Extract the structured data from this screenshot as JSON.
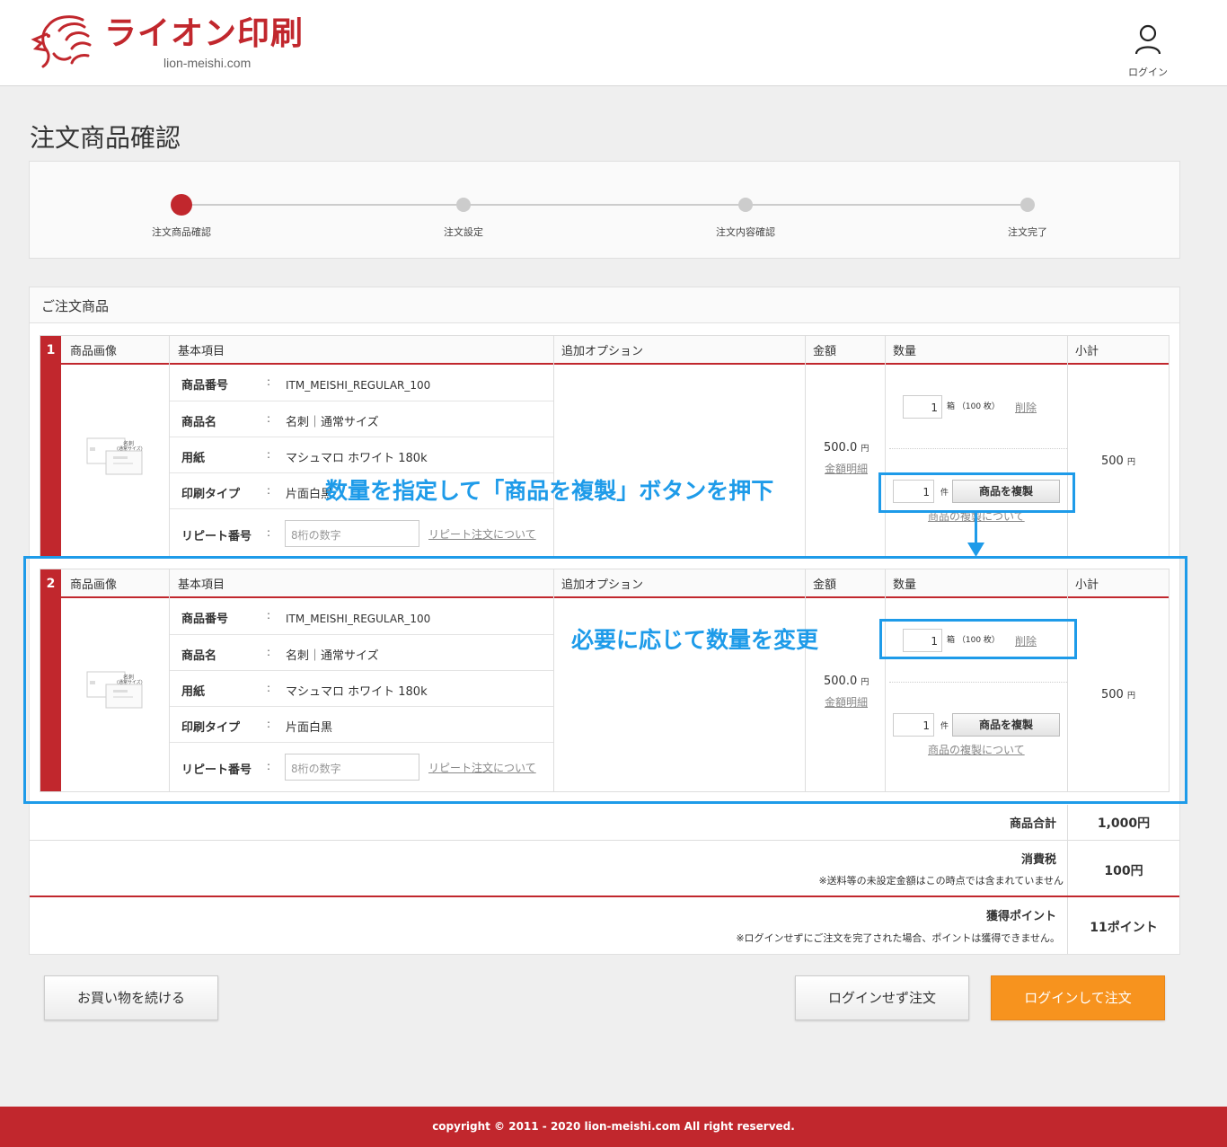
{
  "header": {
    "brand": "ライオン印刷",
    "domain": "lion-meishi.com",
    "login_label": "ログイン"
  },
  "page_title": "注文商品確認",
  "steps": [
    "注文商品確認",
    "注文設定",
    "注文内容確認",
    "注文完了"
  ],
  "order_section_title": "ご注文商品",
  "columns": {
    "image": "商品画像",
    "basic": "基本項目",
    "options": "追加オプション",
    "price": "金額",
    "quantity": "数量",
    "subtotal": "小計"
  },
  "field_labels": {
    "code": "商品番号",
    "name": "商品名",
    "paper": "用紙",
    "print_type": "印刷タイプ",
    "repeat": "リピート番号"
  },
  "colon": ":",
  "items": [
    {
      "num": "1",
      "code": "ITM_MEISHI_REGULAR_100",
      "name": "名刺｜通常サイズ",
      "paper": "マシュマロ ホワイト 180k",
      "print_type": "片面白黒",
      "repeat_placeholder": "8桁の数字",
      "repeat_link": "リピート注文について",
      "price": "500.0",
      "price_unit": "円",
      "price_detail": "金額明細",
      "qty": "1",
      "qty_unit": "箱",
      "qty_note": "（100 枚）",
      "delete": "削除",
      "copy_qty": "1",
      "copy_unit": "件",
      "copy_button": "商品を複製",
      "copy_link": "商品の複製について",
      "subtotal": "500",
      "subtotal_unit": "円",
      "thumb_title": "名刺",
      "thumb_sub": "(通常サイズ)"
    },
    {
      "num": "2",
      "code": "ITM_MEISHI_REGULAR_100",
      "name": "名刺｜通常サイズ",
      "paper": "マシュマロ ホワイト 180k",
      "print_type": "片面白黒",
      "repeat_placeholder": "8桁の数字",
      "repeat_link": "リピート注文について",
      "price": "500.0",
      "price_unit": "円",
      "price_detail": "金額明細",
      "qty": "1",
      "qty_unit": "箱",
      "qty_note": "（100 枚）",
      "delete": "削除",
      "copy_qty": "1",
      "copy_unit": "件",
      "copy_button": "商品を複製",
      "copy_link": "商品の複製について",
      "subtotal": "500",
      "subtotal_unit": "円",
      "thumb_title": "名刺",
      "thumb_sub": "(通常サイズ)"
    }
  ],
  "totals": {
    "goods_label": "商品合計",
    "goods_value": "1,000円",
    "tax_label": "消費税",
    "tax_note": "※送料等の未設定金額はこの時点では含まれていません",
    "tax_value": "100円",
    "points_label": "獲得ポイント",
    "points_note": "※ログインせずにご注文を完了された場合、ポイントは獲得できません。",
    "points_value": "11ポイント"
  },
  "buttons": {
    "continue": "お買い物を続ける",
    "guest_order": "ログインせず注文",
    "login_order": "ログインして注文"
  },
  "annotations": {
    "copy_hint": "数量を指定して「商品を複製」ボタンを押下",
    "change_hint": "必要に応じて数量を変更"
  },
  "footer": {
    "copyright": "copyright © 2011 - 2020 lion-meishi.com All right reserved."
  },
  "colors": {
    "brand": "#c1272d",
    "accent_button": "#f7931e",
    "annotation": "#1e9be9"
  }
}
